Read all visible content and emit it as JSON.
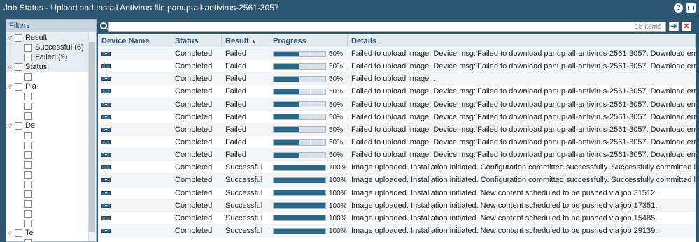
{
  "window": {
    "title": "Job Status - Upload and Install Antivirus file panup-all-antivirus-2561-3057",
    "help_icon": "help-icon",
    "maximize_icon": "maximize-icon"
  },
  "filters": {
    "header": "Filters",
    "groups": [
      {
        "label": "Result",
        "items": [
          {
            "label": "Successful (6)"
          },
          {
            "label": "Failed (9)"
          }
        ]
      },
      {
        "label": "Status"
      },
      {
        "label": "Pla"
      },
      {
        "label": "De"
      },
      {
        "label": "Te"
      }
    ]
  },
  "search": {
    "count": "15 items",
    "go_icon": "arrow-right-icon",
    "clear_icon": "close-icon"
  },
  "table": {
    "columns": {
      "device": "Device Name",
      "status": "Status",
      "result": "Result",
      "progress": "Progress",
      "details": "Details"
    },
    "rows": [
      {
        "status": "Completed",
        "result": "Failed",
        "progress": 0.5,
        "progress_label": "50%",
        "details": "Failed to upload image. Device msg:'Failed to download panup-all-antivirus-2561-3057. Download error: SSL connect error.'. ."
      },
      {
        "status": "Completed",
        "result": "Failed",
        "progress": 0.5,
        "progress_label": "50%",
        "details": "Failed to upload image. Device msg:'Failed to download panup-all-antivirus-2561-3057. Download error: SSL connect error.'. ."
      },
      {
        "status": "Completed",
        "result": "Failed",
        "progress": 0.5,
        "progress_label": "50%",
        "details": "Failed to upload image. ."
      },
      {
        "status": "Completed",
        "result": "Failed",
        "progress": 0.5,
        "progress_label": "50%",
        "details": "Failed to upload image. Device msg:'Failed to download panup-all-antivirus-2561-3057. Download error: SSL connect error.'. ."
      },
      {
        "status": "Completed",
        "result": "Failed",
        "progress": 0.5,
        "progress_label": "50%",
        "details": "Failed to upload image. Device msg:'Failed to download panup-all-antivirus-2561-3057. Download error: SSL connect error.'. ."
      },
      {
        "status": "Completed",
        "result": "Failed",
        "progress": 0.5,
        "progress_label": "50%",
        "details": "Failed to upload image. Device msg:'Failed to download panup-all-antivirus-2561-3057. Download error: SSL connect error.'. ."
      },
      {
        "status": "Completed",
        "result": "Failed",
        "progress": 0.5,
        "progress_label": "50%",
        "details": "Failed to upload image. Device msg:'Failed to download panup-all-antivirus-2561-3057. Download error: SSL connect error.'. ."
      },
      {
        "status": "Completed",
        "result": "Failed",
        "progress": 0.5,
        "progress_label": "50%",
        "details": "Failed to upload image. Device msg:'Failed to download panup-all-antivirus-2561-3057. Download error: SSL connect error.'. ."
      },
      {
        "status": "Completed",
        "result": "Failed",
        "progress": 0.5,
        "progress_label": "50%",
        "details": "Failed to upload image. Device msg:'Failed to download panup-all-antivirus-2561-3057. Download error: SSL connect error.'. ."
      },
      {
        "status": "Completed",
        "result": "Successful",
        "progress": 1.0,
        "progress_label": "100%",
        "details": "Image uploaded. Installation initiated. Configuration committed successfully. Successfully committed last configuration."
      },
      {
        "status": "Completed",
        "result": "Successful",
        "progress": 1.0,
        "progress_label": "100%",
        "details": "Image uploaded. Installation initiated. Configuration committed successfully. Successfully committed last configuration."
      },
      {
        "status": "Completed",
        "result": "Successful",
        "progress": 1.0,
        "progress_label": "100%",
        "details": "Image uploaded. Installation initiated. New content scheduled to be pushed via job 31512."
      },
      {
        "status": "Completed",
        "result": "Successful",
        "progress": 1.0,
        "progress_label": "100%",
        "details": "Image uploaded. Installation initiated. New content scheduled to be pushed via job 17351."
      },
      {
        "status": "Completed",
        "result": "Successful",
        "progress": 1.0,
        "progress_label": "100%",
        "details": "Image uploaded. Installation initiated. New content scheduled to be pushed via job 15485."
      },
      {
        "status": "Completed",
        "result": "Successful",
        "progress": 1.0,
        "progress_label": "100%",
        "details": "Image uploaded. Installation initiated. New content scheduled to be pushed via job 29139."
      }
    ]
  },
  "colors": {
    "chrome": "#2d5671",
    "progress_fill": "#2a6686"
  }
}
